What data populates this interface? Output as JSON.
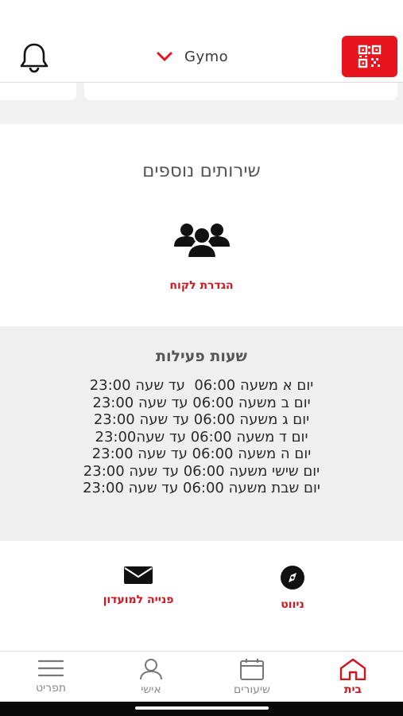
{
  "header": {
    "title": "Gymo",
    "accent_color": "#e8141e",
    "bell_icon": "bell-icon",
    "chevron_icon": "chevron-down-icon",
    "qr_icon": "qr-code-icon"
  },
  "services": {
    "title": "שירותים נוספים",
    "item_label": "הגדרת לקוח",
    "item_icon": "people-group-icon"
  },
  "hours": {
    "title": "שעות פעילות",
    "lines": [
      "יום א משעה 06:00  עד שעה 23:00",
      "יום ב משעה 06:00 עד שעה 23:00",
      "יום ג משעה 06:00 עד שעה 23:00",
      "יום ד משעה 06:00 עד שעה23:00",
      "יום ה משעה 06:00 עד שעה 23:00",
      "יום שישי משעה 06:00 עד שעה 23:00",
      "יום שבת משעה 06:00 עד שעה 23:00"
    ]
  },
  "actions": {
    "contact_label": "פנייה למועדון",
    "contact_icon": "envelope-icon",
    "navigate_label": "ניווט",
    "navigate_icon": "compass-icon"
  },
  "tabbar": {
    "menu": "תפריט",
    "personal": "אישי",
    "classes": "שיעורים",
    "home": "בית",
    "active": "home"
  }
}
